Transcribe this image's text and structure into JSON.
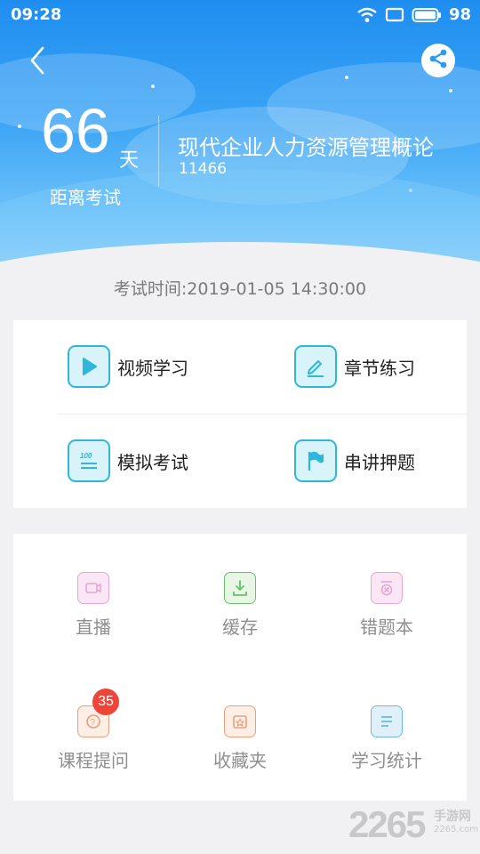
{
  "status_bar": {
    "time": "09:28",
    "battery": "98",
    "icons": [
      "wifi-icon",
      "screen-icon",
      "battery-icon"
    ]
  },
  "header": {
    "back_icon": "chevron-left-icon",
    "share_icon": "share-icon",
    "days_count": "66",
    "days_unit": "天",
    "days_label": "距离考试",
    "course_title": "现代企业人力资源管理概论",
    "course_code": "11466"
  },
  "exam_time": "考试时间:2019-01-05 14:30:00",
  "main_actions": [
    {
      "label": "视频学习",
      "icon": "play-icon"
    },
    {
      "label": "章节练习",
      "icon": "pencil-icon"
    },
    {
      "label": "模拟考试",
      "icon": "exam-paper-icon"
    },
    {
      "label": "串讲押题",
      "icon": "flag-icon"
    }
  ],
  "tools": [
    {
      "label": "直播",
      "icon": "video-camera-icon",
      "color": "#e6a6d6"
    },
    {
      "label": "缓存",
      "icon": "download-icon",
      "color": "#6cbf6a"
    },
    {
      "label": "错题本",
      "icon": "wrong-book-icon",
      "color": "#e6a6d6"
    },
    {
      "label": "课程提问",
      "icon": "question-icon",
      "color": "#e8a07a",
      "badge": "35"
    },
    {
      "label": "收藏夹",
      "icon": "favorite-icon",
      "color": "#e8a07a"
    },
    {
      "label": "学习统计",
      "icon": "statistics-icon",
      "color": "#6fb8dc"
    }
  ],
  "colors": {
    "header_blue": "#1f8ef0",
    "accent_cyan": "#2fb7d9",
    "badge_red": "#f04438"
  },
  "watermark": {
    "number": "2265",
    "text": "手游网",
    "url": "2265.com"
  }
}
